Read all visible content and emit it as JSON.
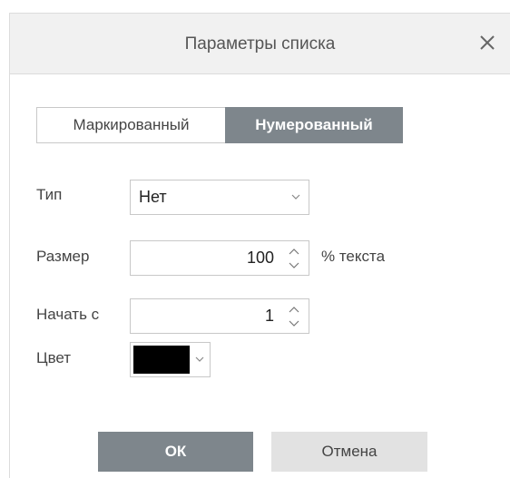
{
  "dialog": {
    "title": "Параметры списка",
    "close_icon": "close-icon"
  },
  "tabs": [
    {
      "label": "Маркированный",
      "selected": false
    },
    {
      "label": "Нумерованный",
      "selected": true
    }
  ],
  "form": {
    "type_label": "Тип",
    "type_value": "Нет",
    "size_label": "Размер",
    "size_value": "100",
    "size_suffix": "% текста",
    "start_label": "Начать с",
    "start_value": "1",
    "color_label": "Цвет",
    "color_value": "#000000"
  },
  "buttons": {
    "ok": "ОК",
    "cancel": "Отмена"
  },
  "colors": {
    "accent": "#7e868c",
    "header_bg": "#f1f1f1",
    "cancel_bg": "#e2e2e2"
  }
}
